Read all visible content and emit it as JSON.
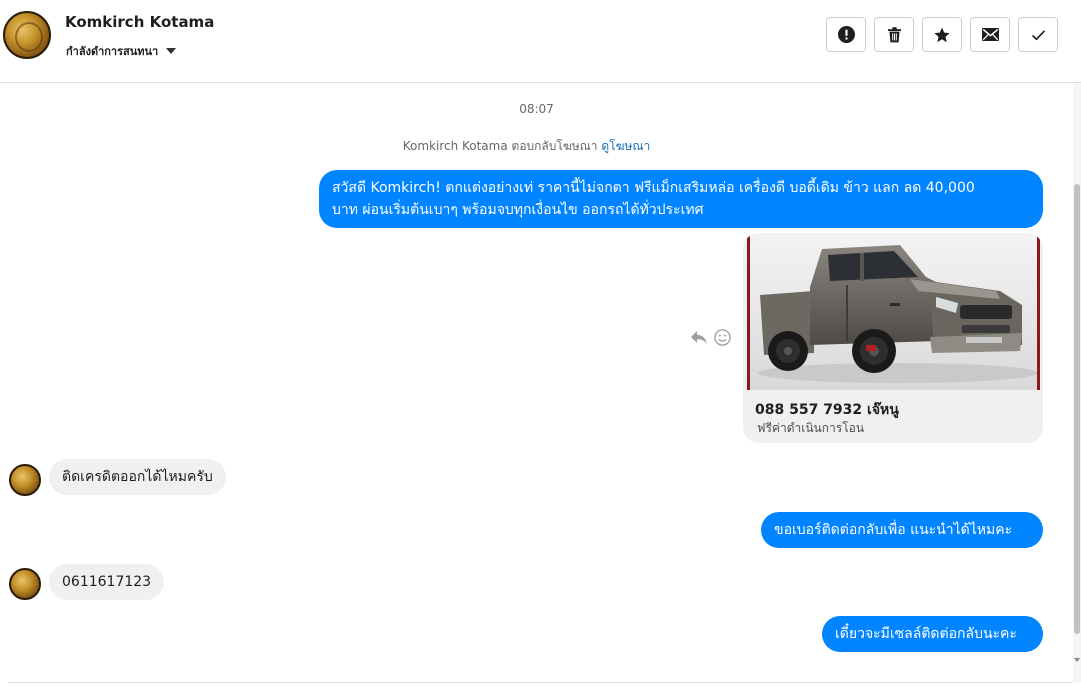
{
  "header": {
    "contact_name": "Komkirch Kotama",
    "contact_status": "กำลังดำการสนทนา",
    "actions": [
      {
        "name": "mark-spam",
        "icon": "alert-circle-icon"
      },
      {
        "name": "delete",
        "icon": "trash-icon"
      },
      {
        "name": "star",
        "icon": "star-icon"
      },
      {
        "name": "mark-unread",
        "icon": "envelope-icon"
      },
      {
        "name": "mark-done",
        "icon": "check-icon"
      }
    ]
  },
  "thread": {
    "timestamp": "08:07",
    "ad_reply_text": "Komkirch Kotama ตอบกลับโฆษณา",
    "ad_reply_link": "ดูโฆษณา",
    "messages": [
      {
        "direction": "out",
        "lines": [
          "สวัสดี Komkirch! ตกแต่งอย่างเท่ ราคานี้ไม่จกตา ฟรีแม็กเสริมหล่อ เครื่องดี บอดี้เดิม ข้าว แลก ลด 40,000",
          "บาท ผ่อนเริ่มต้นเบาๆ พร้อมจบทุกเงื่อนไข ออกรถได้ทั่วประเทศ"
        ]
      },
      {
        "direction": "in",
        "text": "ติดเครดิตออกได้ไหมครับ"
      },
      {
        "direction": "out",
        "text": "ขอเบอร์ติดต่อกลับเพื่อ แนะนำได้ไหมคะ"
      },
      {
        "direction": "in",
        "text": "0611617123"
      },
      {
        "direction": "out",
        "text": "เดี๋ยวจะมีเซลล์ติดต่อกลับนะคะ"
      }
    ],
    "ad_card": {
      "title": "088 557 7932 เจ๊หนู",
      "subtitle": "ฟรีค่าดำเนินการโอน",
      "image": "pickup-truck-photo"
    }
  },
  "colors": {
    "outgoing_bubble": "#0084ff",
    "incoming_bubble": "#f1f0f0",
    "link": "#1a6fb5"
  }
}
